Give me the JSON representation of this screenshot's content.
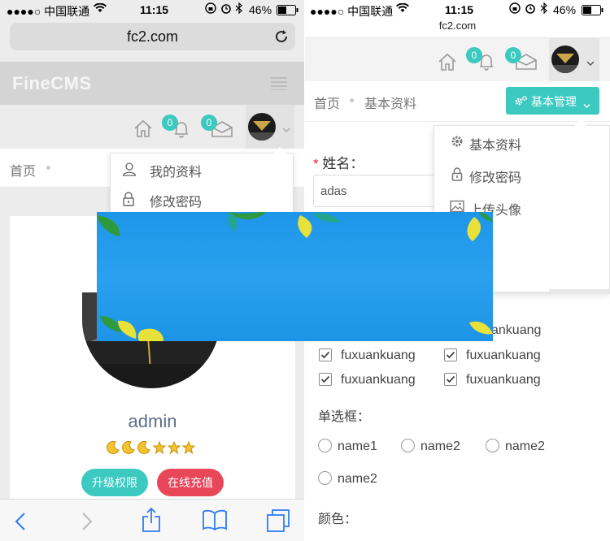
{
  "left": {
    "status": {
      "carrier": "●●●●○ 中国联通",
      "time": "11:15",
      "battery": "46%"
    },
    "url": "fc2.com",
    "brand": "FineCMS",
    "badges": {
      "bell": "0",
      "mail": "0"
    },
    "breadcrumb": {
      "home": "首页"
    },
    "dropdown": {
      "items": [
        {
          "label": "我的资料",
          "icon": "user-icon"
        },
        {
          "label": "修改密码",
          "icon": "lock-icon"
        }
      ]
    },
    "profile": {
      "username": "admin",
      "level_icons": [
        "moon-icon",
        "moon-icon",
        "moon-icon",
        "star-icon",
        "star-icon",
        "star-icon"
      ]
    },
    "buttons": {
      "upgrade": "升级权限",
      "recharge": "在线充值"
    },
    "toolbar": [
      "back-icon",
      "forward-icon",
      "share-icon",
      "bookmarks-icon",
      "tabs-icon"
    ]
  },
  "right": {
    "status": {
      "carrier": "●●●●○ 中国联通",
      "time": "11:15",
      "battery": "46%"
    },
    "url": "fc2.com",
    "badges": {
      "bell": "0",
      "mail": "0"
    },
    "breadcrumb": {
      "home": "首页",
      "current": "基本资料"
    },
    "manage_button": "基本管理",
    "dropdown": {
      "items": [
        {
          "label": "基本资料",
          "icon": "gear-icon"
        },
        {
          "label": "修改密码",
          "icon": "lock-icon"
        },
        {
          "label": "上传头像",
          "icon": "image-icon"
        }
      ]
    },
    "form": {
      "name_label": "姓名：",
      "name_value": "adas",
      "checkbox_partial": "ankuang",
      "checkboxes": [
        {
          "label": "fuxuankuang"
        },
        {
          "label": "fuxuankuang"
        },
        {
          "label": "fuxuankuang"
        },
        {
          "label": "fuxuankuang"
        }
      ],
      "radio_label": "单选框：",
      "radios": [
        {
          "label": "name1"
        },
        {
          "label": "name2"
        },
        {
          "label": "name2"
        },
        {
          "label": "name2"
        }
      ],
      "color_label": "颜色："
    }
  },
  "colors": {
    "teal": "#3bc9c0",
    "red": "#e8475a",
    "ios_blue": "#2d7cf6",
    "banner_blue": "#1e96e8",
    "leaf_yellow": "#e7e13a",
    "leaf_green": "#2f9a3d"
  }
}
